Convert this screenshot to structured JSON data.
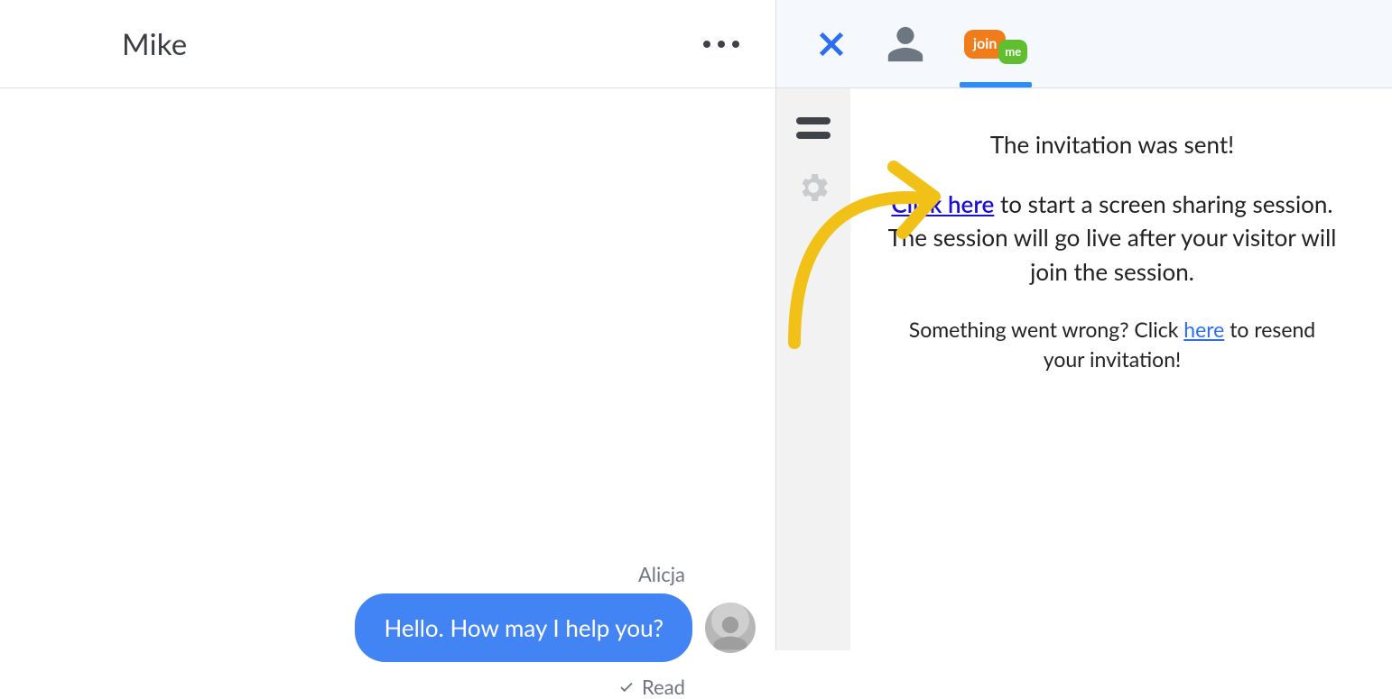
{
  "chat": {
    "title": "Mike",
    "message": {
      "sender": "Alicja",
      "text": "Hello. How may I help you?",
      "status": "Read"
    }
  },
  "side": {
    "joinme": {
      "join": "join",
      "me": "me"
    },
    "line1": "The invitation was sent!",
    "line2_link": "Click here",
    "line2_rest": " to start a screen sharing session. The session will go live after your visitor will join the session.",
    "line3_pre": "Something went wrong? Click ",
    "line3_link": "here",
    "line3_post": " to resend your invitation!"
  }
}
